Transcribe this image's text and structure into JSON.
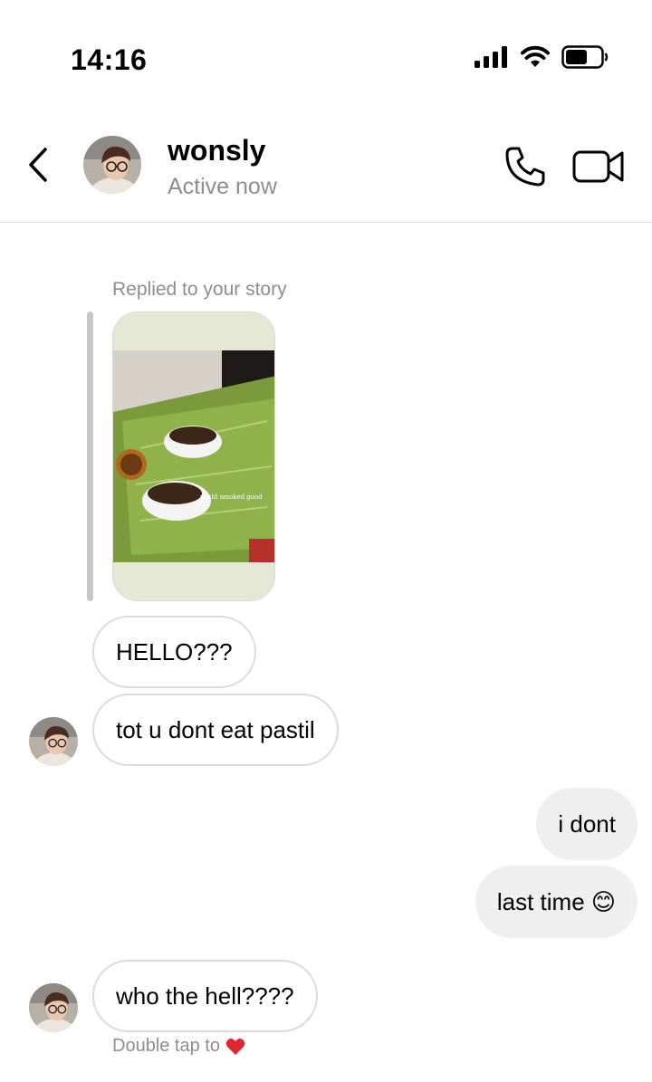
{
  "status_bar": {
    "time": "14:16",
    "icons": [
      "signal-icon",
      "wifi-icon",
      "battery-icon"
    ]
  },
  "header": {
    "back_icon": "chevron-left-icon",
    "name": "wonsly",
    "status": "Active now",
    "call_icon": "phone-icon",
    "video_icon": "video-camera-icon"
  },
  "thread": {
    "story_reply": {
      "label": "Replied to your story",
      "story_caption": "pastil smoked good"
    },
    "messages": [
      {
        "sender": "them",
        "text": "HELLO???"
      },
      {
        "sender": "them",
        "text": "tot u dont eat pastil"
      },
      {
        "sender": "me",
        "text": "i dont"
      },
      {
        "sender": "me",
        "text": "last time 😊"
      },
      {
        "sender": "them",
        "text": "who the hell????"
      }
    ],
    "hint": {
      "text": "Double tap to",
      "icon": "heart-icon"
    }
  },
  "colors": {
    "secondary_text": "#8e8e8e",
    "incoming_border": "#dbdbdb",
    "outgoing_bg": "#efefef",
    "heart": "#e0252f"
  }
}
